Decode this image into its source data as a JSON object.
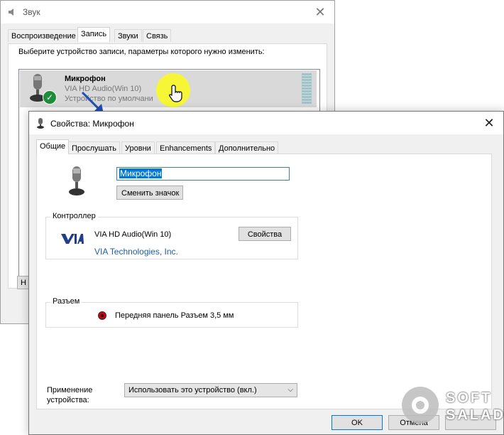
{
  "back_window": {
    "title": "Звук",
    "tabs": [
      {
        "label": "Воспроизведение",
        "active": false
      },
      {
        "label": "Запись",
        "active": true
      },
      {
        "label": "Звуки",
        "active": false
      },
      {
        "label": "Связь",
        "active": false
      }
    ],
    "instruction": "Выберите устройство записи, параметры которого нужно изменить:",
    "device": {
      "name": "Микрофон",
      "driver": "VIA HD Audio(Win 10)",
      "status": "Устройство по умолчани"
    },
    "partial_button": "Н"
  },
  "front_window": {
    "title": "Свойства: Микрофон",
    "tabs": [
      {
        "label": "Общие",
        "active": true
      },
      {
        "label": "Прослушать",
        "active": false
      },
      {
        "label": "Уровни",
        "active": false
      },
      {
        "label": "Enhancements",
        "active": false
      },
      {
        "label": "Дополнительно",
        "active": false
      }
    ],
    "device_name_value": "Микрофон",
    "change_icon_label": "Сменить значок",
    "controller": {
      "label": "Контроллер",
      "name": "VIA HD Audio(Win 10)",
      "vendor_link": "VIA Technologies, Inc.",
      "properties_button": "Свойства"
    },
    "jack": {
      "label": "Разъем",
      "text": "Передняя панель Разъем 3,5 мм"
    },
    "usage": {
      "label_line1": "Применение",
      "label_line2": "устройства:",
      "selected": "Использовать это устройство (вкл.)"
    },
    "buttons": {
      "ok": "OK",
      "cancel": "Отмена"
    }
  },
  "watermark": {
    "line1": "SOFT",
    "line2": "SALAD"
  },
  "colors": {
    "accent": "#0078d7",
    "link": "#1f5e9e",
    "highlight": "#ffff00",
    "check": "#1e8c3a"
  }
}
